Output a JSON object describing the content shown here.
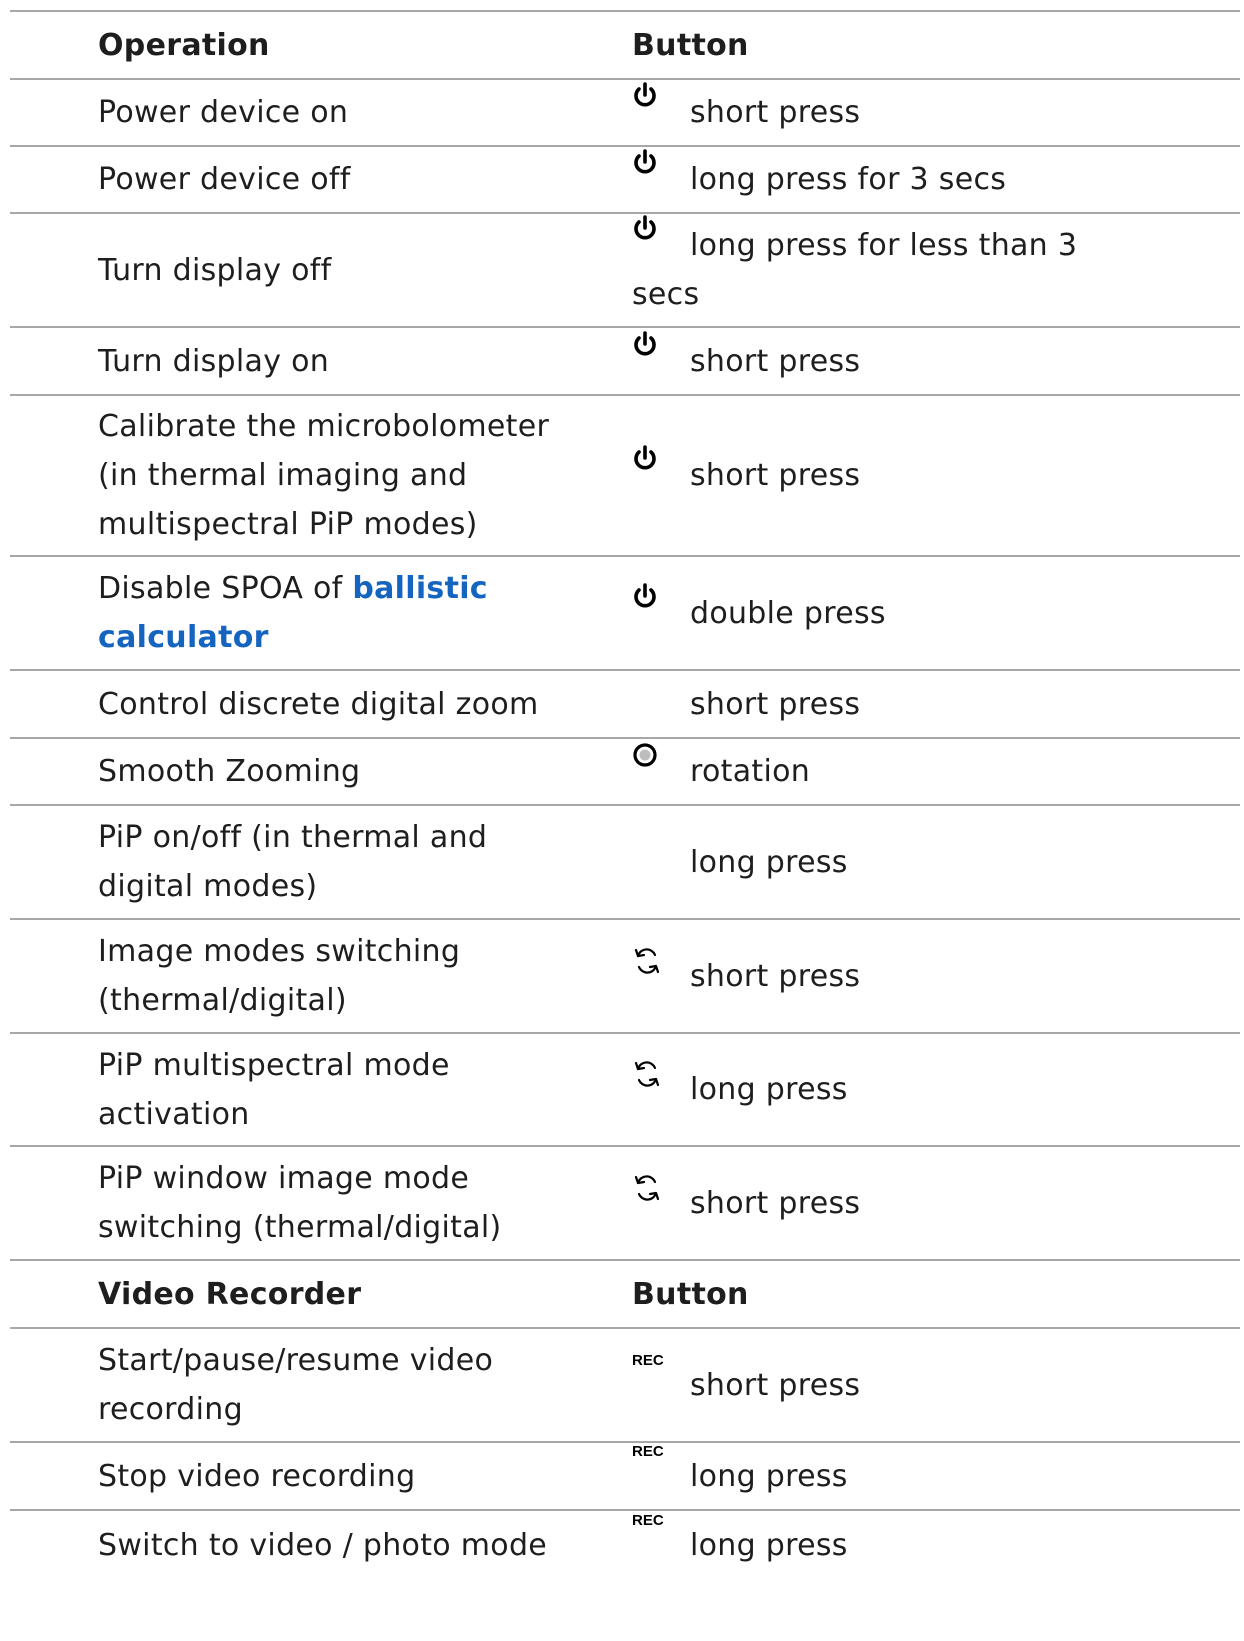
{
  "section1": {
    "header": {
      "operation": "Operation",
      "button": "Button"
    },
    "rows": [
      {
        "operation": "Power device on",
        "icon": "power-icon",
        "action": "short press"
      },
      {
        "operation": "Power device off",
        "icon": "power-icon",
        "action": "long press for 3 secs"
      },
      {
        "operation": "Turn display off",
        "icon": "power-icon",
        "action": "long press for less than 3",
        "action_line2": "secs"
      },
      {
        "operation": "Turn display on",
        "icon": "power-icon",
        "action": "short press"
      },
      {
        "operation_lines": [
          "Calibrate the microbolometer",
          "(in thermal imaging and",
          "multispectral PiP modes)"
        ],
        "icon": "power-icon",
        "action": "short press"
      },
      {
        "operation_prefix": "Disable SPOA of ",
        "operation_link": "ballistic",
        "operation_link2": "calculator",
        "icon": "power-icon",
        "action": "double press"
      },
      {
        "operation": "Control discrete digital zoom",
        "icon": "",
        "action": "short press"
      },
      {
        "operation": "Smooth Zooming",
        "icon": "dial-icon",
        "action": "rotation"
      },
      {
        "operation_lines": [
          "PiP on/off (in thermal and",
          "digital modes)"
        ],
        "icon": "",
        "action": "long press"
      },
      {
        "operation_lines": [
          "Image modes switching",
          "(thermal/digital)"
        ],
        "icon": "mode-switch-icon",
        "action": "short press"
      },
      {
        "operation_lines": [
          "PiP multispectral mode",
          "activation"
        ],
        "icon": "mode-switch-icon",
        "action": "long press"
      },
      {
        "operation_lines": [
          "PiP window image mode",
          "switching (thermal/digital)"
        ],
        "icon": "mode-switch-icon",
        "action": "short press"
      }
    ]
  },
  "section2": {
    "header": {
      "operation": "Video Recorder",
      "button": "Button"
    },
    "rows": [
      {
        "operation_lines": [
          "Start/pause/resume video",
          "recording"
        ],
        "icon": "rec-icon",
        "icon_text": "REC",
        "action": "short press"
      },
      {
        "operation": "Stop video recording",
        "icon": "rec-icon",
        "icon_text": "REC",
        "action": "long press"
      },
      {
        "operation": "Switch to video / photo mode",
        "icon": "rec-icon",
        "icon_text": "REC",
        "action": "long press"
      }
    ]
  },
  "colors": {
    "link": "#1565c0",
    "rule": "#a7a7a7",
    "text": "#1e1e1e"
  }
}
